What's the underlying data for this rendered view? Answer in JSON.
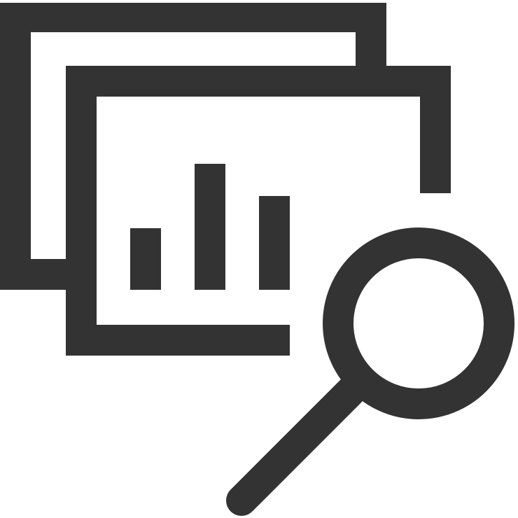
{
  "icon": {
    "name": "data-analysis-search-icon",
    "color": "#333333",
    "background": "#ffffff"
  }
}
